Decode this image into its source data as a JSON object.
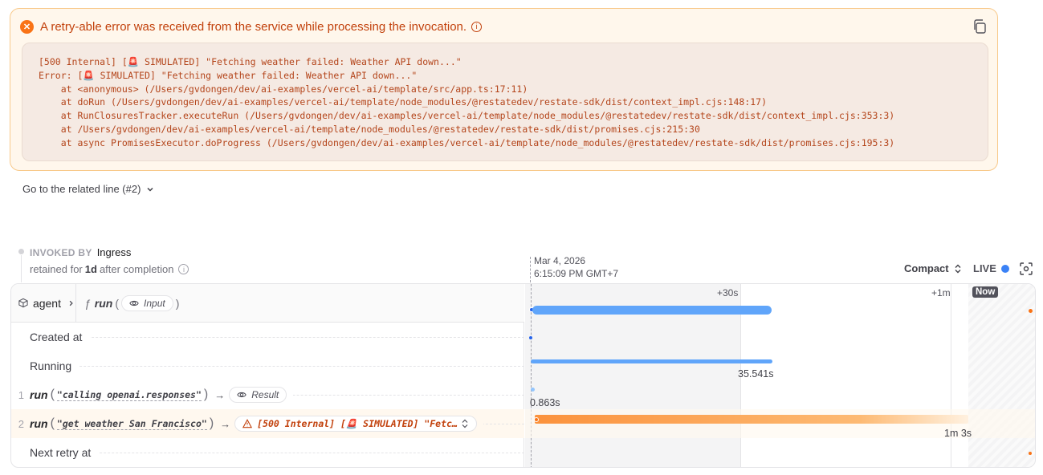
{
  "error": {
    "title": "A retry-able error was received from the service while processing the invocation.",
    "stack": [
      "[500 Internal] [🚨 SIMULATED] \"Fetching weather failed: Weather API down...\"",
      "Error: [🚨 SIMULATED] \"Fetching weather failed: Weather API down...\"",
      "    at <anonymous> (/Users/gvdongen/dev/ai-examples/vercel-ai/template/src/app.ts:17:11)",
      "    at doRun (/Users/gvdongen/dev/ai-examples/vercel-ai/template/node_modules/@restatedev/restate-sdk/dist/context_impl.cjs:148:17)",
      "    at RunClosuresTracker.executeRun (/Users/gvdongen/dev/ai-examples/vercel-ai/template/node_modules/@restatedev/restate-sdk/dist/context_impl.cjs:353:3)",
      "    at /Users/gvdongen/dev/ai-examples/vercel-ai/template/node_modules/@restatedev/restate-sdk/dist/promises.cjs:215:30",
      "    at async PromisesExecutor.doProgress (/Users/gvdongen/dev/ai-examples/vercel-ai/template/node_modules/@restatedev/restate-sdk/dist/promises.cjs:195:3)"
    ]
  },
  "goto_label": "Go to the related line (#2)",
  "invoked": {
    "label": "INVOKED BY",
    "value": "Ingress",
    "retained_prefix": "retained for",
    "retained_value": "1d",
    "retained_suffix": "after completion"
  },
  "timeline_header": {
    "date": "Mar 4, 2026",
    "time": "6:15:09 PM GMT+7",
    "view_mode": "Compact",
    "live_label": "LIVE"
  },
  "ticks": {
    "t30": "+30s",
    "t1m": "+1m",
    "now": "Now"
  },
  "service": {
    "name": "agent",
    "fn_symbol": "ƒ",
    "handler": "run",
    "input_label": "Input"
  },
  "rows": {
    "created_at": "Created at",
    "running": "Running",
    "running_duration": "35.541s",
    "next_retry": "Next retry at"
  },
  "steps": [
    {
      "num": "1",
      "name": "run",
      "arg": "\"calling openai.responses\"",
      "result_label": "Result",
      "duration": "0.863s"
    },
    {
      "num": "2",
      "name": "run",
      "arg": "\"get weather San Francisco\"",
      "error_label": "[500 Internal] [🚨 SIMULATED] \"Fetc…",
      "duration": "1m 3s"
    }
  ],
  "colors": {
    "accent_blue": "#60a5fa",
    "error_orange": "#f97316",
    "error_text": "#c2410c"
  }
}
